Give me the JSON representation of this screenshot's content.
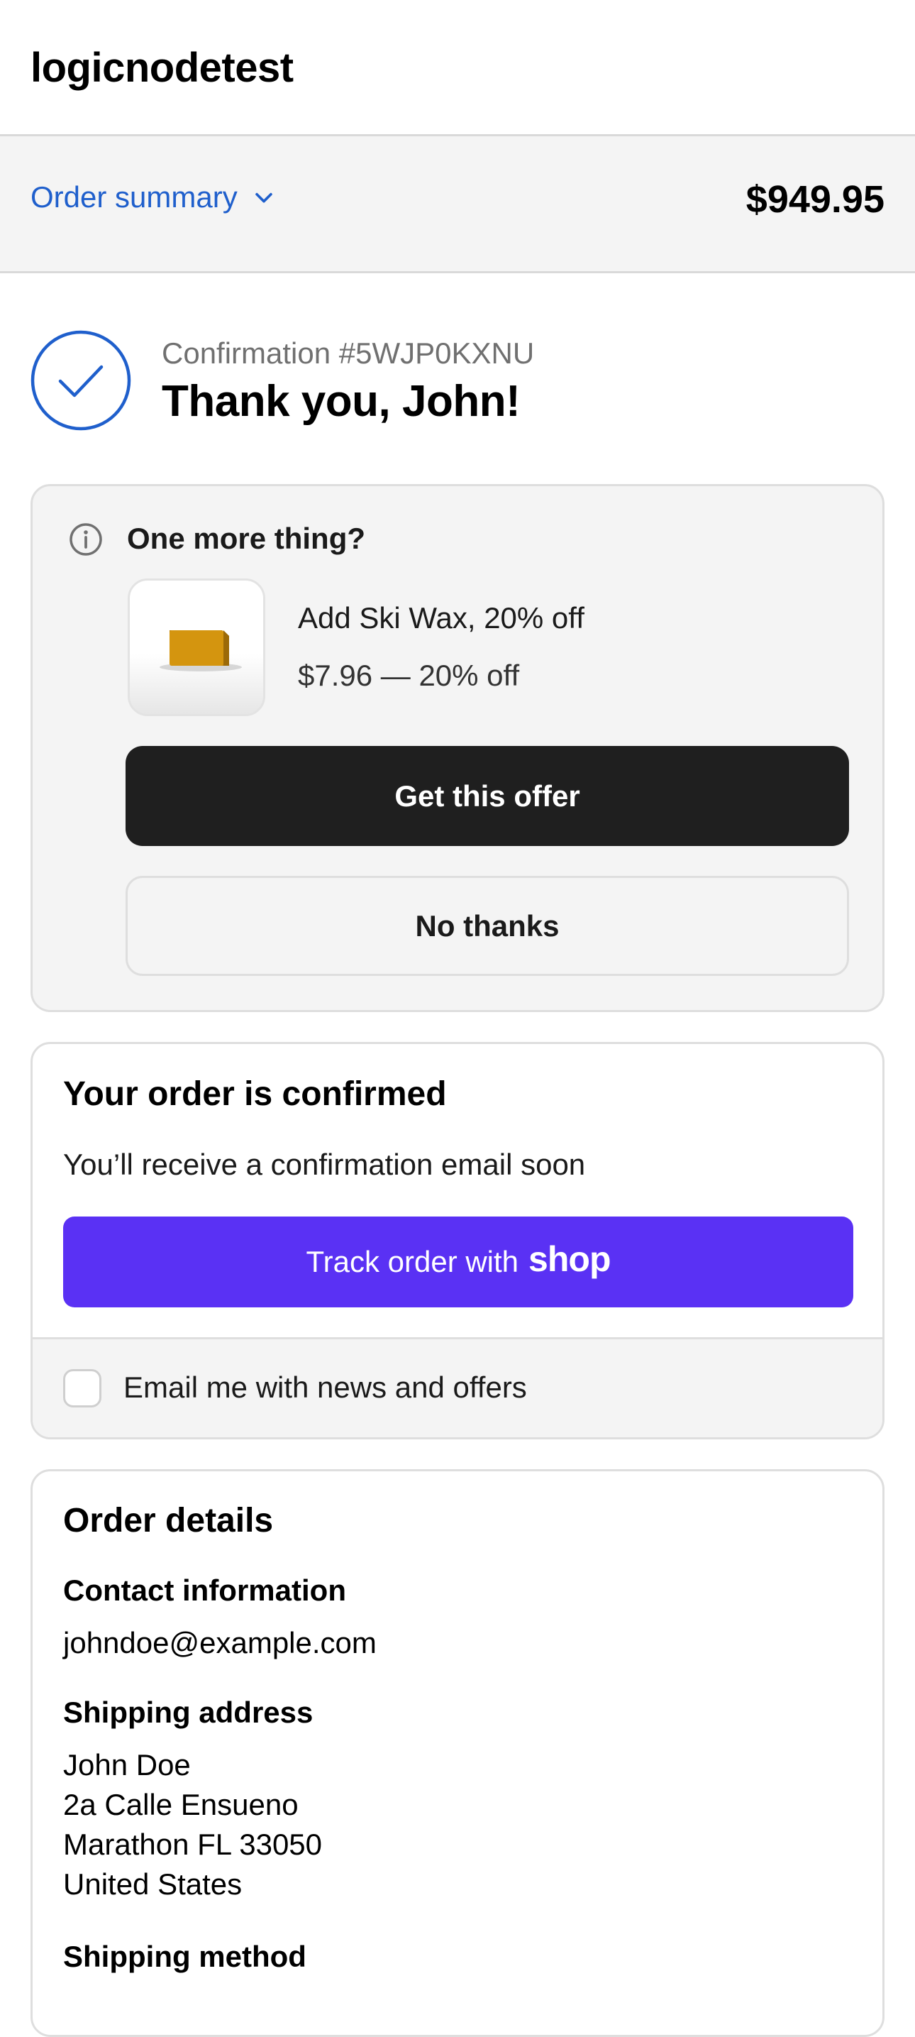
{
  "header": {
    "store_name": "logicnodetest"
  },
  "summary": {
    "toggle_label": "Order summary",
    "total": "$949.95"
  },
  "confirmation": {
    "number_text": "Confirmation #5WJP0KXNU",
    "thank_you": "Thank you, John!"
  },
  "upsell": {
    "title": "One more thing?",
    "product_name": "Add Ski Wax, 20% off",
    "product_price": "$7.96 — 20% off",
    "accept_label": "Get this offer",
    "decline_label": "No thanks"
  },
  "confirmed": {
    "title": "Your order is confirmed",
    "message": "You’ll receive a confirmation email soon",
    "track_label": "Track order with",
    "track_logo": "shop",
    "optin_label": "Email me with news and offers"
  },
  "details": {
    "title": "Order details",
    "contact_heading": "Contact information",
    "contact_email": "johndoe@example.com",
    "shipping_heading": "Shipping address",
    "shipping_lines": [
      "John Doe",
      "2a Calle Ensueno",
      "Marathon FL 33050",
      "United States"
    ],
    "method_heading": "Shipping method"
  },
  "colors": {
    "link": "#1f5fcc",
    "shop_purple": "#5a31f4",
    "primary_button": "#1f1f1f",
    "panel_bg": "#f4f4f4"
  }
}
